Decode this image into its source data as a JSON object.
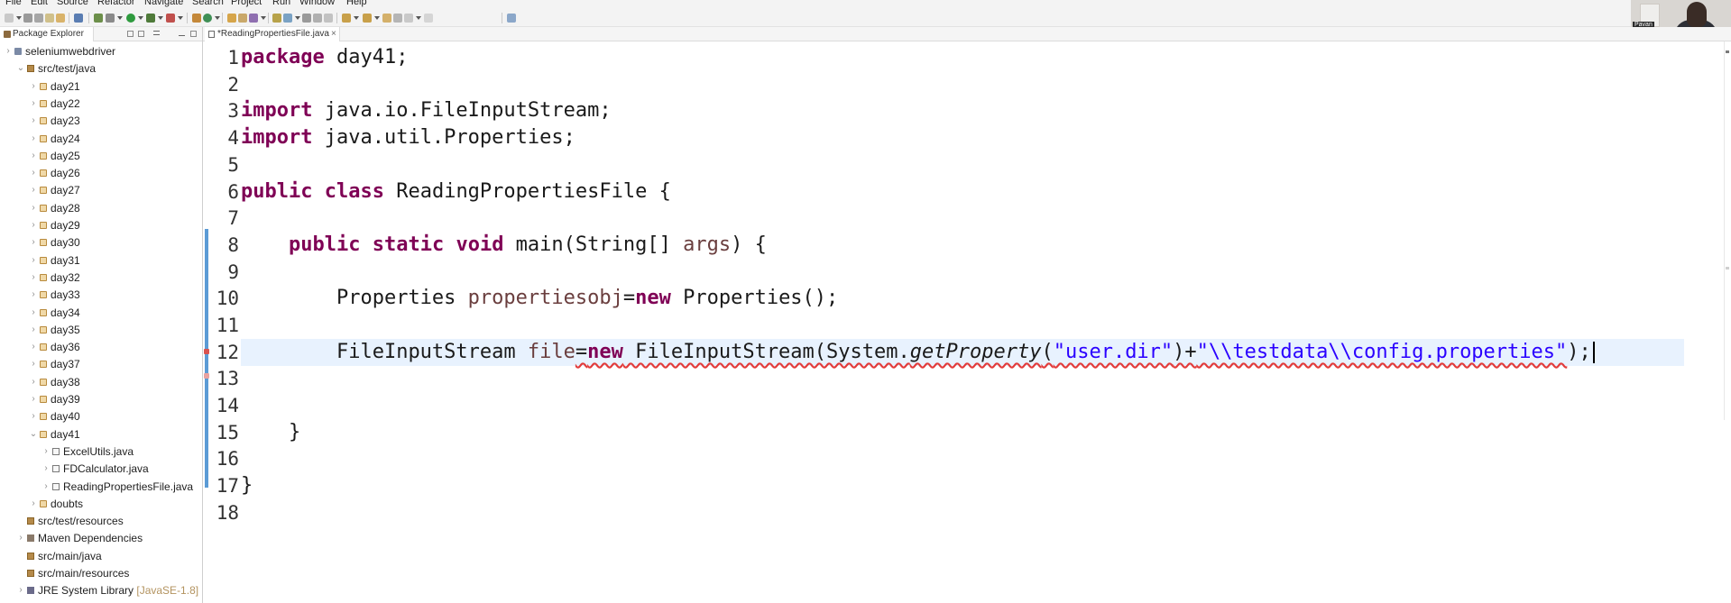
{
  "menu": [
    "File",
    "Edit",
    "Source",
    "Refactor",
    "Navigate",
    "Search",
    "Project",
    "Run",
    "Window",
    "Help"
  ],
  "webcam": {
    "name_tag": "Pavan"
  },
  "explorer": {
    "tab_label": "Package Explorer",
    "project": "seleniumwebdriver",
    "src_test_java": "src/test/java",
    "packages": [
      "day21",
      "day22",
      "day23",
      "day24",
      "day25",
      "day26",
      "day27",
      "day28",
      "day29",
      "day30",
      "day31",
      "day32",
      "day33",
      "day34",
      "day35",
      "day36",
      "day37",
      "day38",
      "day39",
      "day40"
    ],
    "open_package": "day41",
    "files": [
      "ExcelUtils.java",
      "FDCalculator.java",
      "ReadingPropertiesFile.java"
    ],
    "doubts": "doubts",
    "src_test_resources": "src/test/resources",
    "maven_deps": "Maven Dependencies",
    "src_main_java": "src/main/java",
    "src_main_resources": "src/main/resources",
    "jre": {
      "label": "JRE System Library",
      "decoration": "[JavaSE-1.8]"
    }
  },
  "editor": {
    "tab_label": "*ReadingPropertiesFile.java",
    "close_glyph": "×",
    "line_numbers": [
      "1",
      "2",
      "3",
      "4",
      "5",
      "6",
      "7",
      "8",
      "9",
      "10",
      "11",
      "12",
      "13",
      "14",
      "15",
      "16",
      "17",
      "18"
    ],
    "code": {
      "l1_kw": "package",
      "l1_rest": " day41;",
      "l3_kw": "import",
      "l3_rest": " java.io.FileInputStream;",
      "l4_kw": "import",
      "l4_rest": " java.util.Properties;",
      "l6_kw1": "public",
      "l6_kw2": "class",
      "l6_rest": " ReadingPropertiesFile {",
      "l8_kw1": "public",
      "l8_kw2": "static",
      "l8_kw3": "void",
      "l8_mid": " main(String[] ",
      "l8_var": "args",
      "l8_end": ") {",
      "l10_type": "Properties ",
      "l10_var": "propertiesobj",
      "l10_eq": "=",
      "l10_kw": "new",
      "l10_end": " Properties();",
      "l12_type": "FileInputStream ",
      "l12_var": "file",
      "l12_eq": "=",
      "l12_kw": "new",
      "l12_ctor": " FileInputStream(System.",
      "l12_method": "getProperty",
      "l12_open": "(",
      "l12_str1": "\"user.dir\"",
      "l12_plus": ")+",
      "l12_str2": "\"\\\\testdata\\\\config.properties\"",
      "l12_end": ");",
      "l15": "}",
      "l17": "}"
    }
  }
}
